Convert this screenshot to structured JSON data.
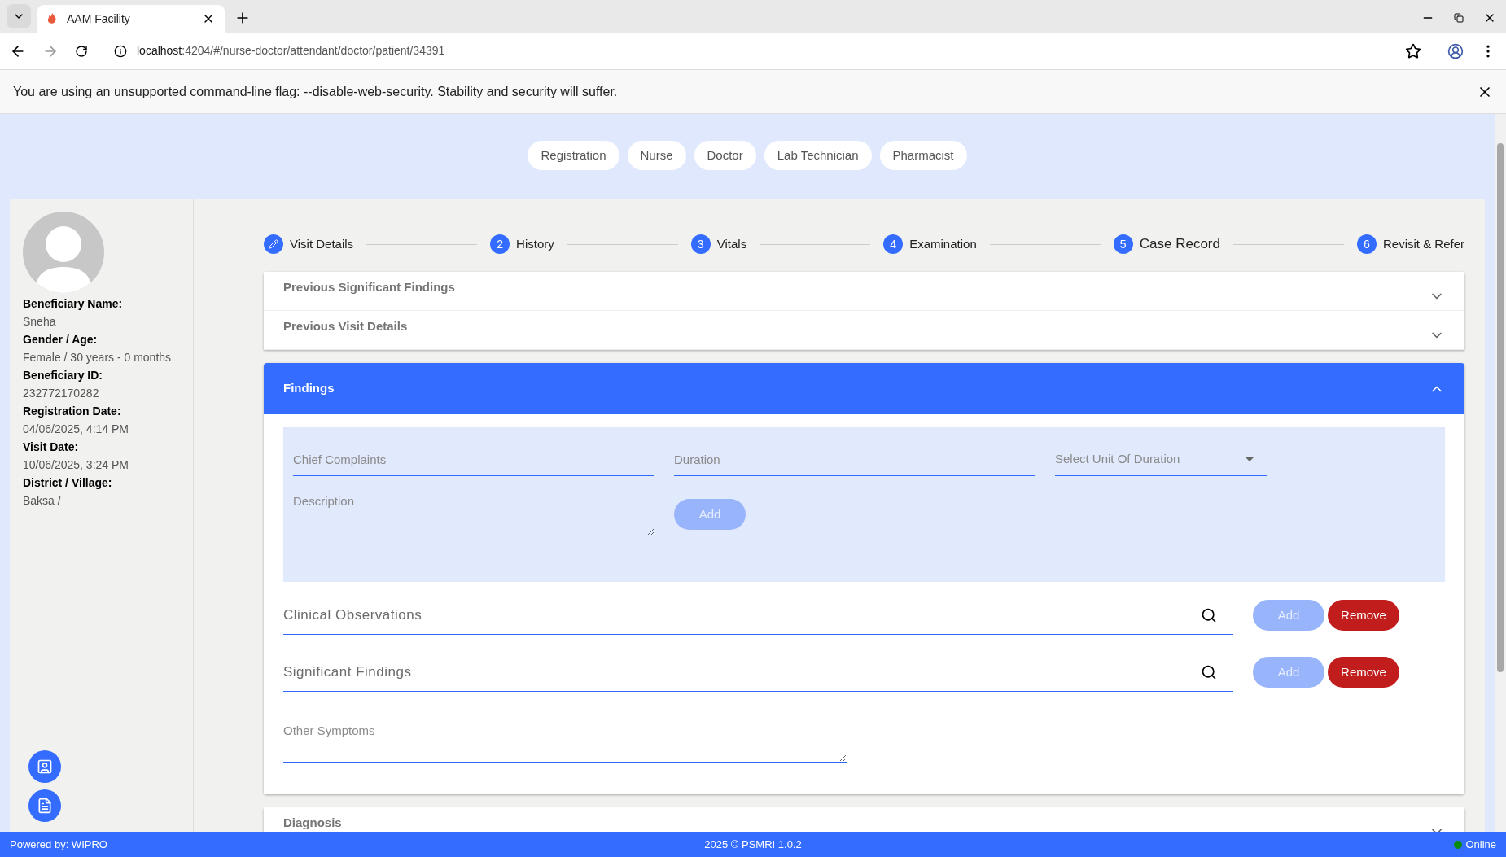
{
  "browser": {
    "tab_title": "AAM Facility",
    "url_host": "localhost",
    "url_path": ":4204/#/nurse-doctor/attendant/doctor/patient/34391"
  },
  "warning": {
    "text": "You are using an unsupported command-line flag: --disable-web-security. Stability and security will suffer."
  },
  "role_tabs": [
    {
      "label": "Registration"
    },
    {
      "label": "Nurse"
    },
    {
      "label": "Doctor"
    },
    {
      "label": "Lab Technician"
    },
    {
      "label": "Pharmacist"
    }
  ],
  "beneficiary": [
    {
      "label": "Beneficiary Name:",
      "value": "Sneha"
    },
    {
      "label": "Gender / Age:",
      "value": "Female / 30 years - 0 months"
    },
    {
      "label": "Beneficiary ID:",
      "value": "232772170282"
    },
    {
      "label": "Registration Date:",
      "value": "04/06/2025, 4:14 PM"
    },
    {
      "label": "Visit Date:",
      "value": "10/06/2025, 3:24 PM"
    },
    {
      "label": "District / Village:",
      "value": "Baksa /"
    }
  ],
  "stepper": [
    {
      "kind": "edit",
      "label": "Visit Details",
      "selected": false
    },
    {
      "kind": "number",
      "number": "2",
      "label": "History",
      "selected": false
    },
    {
      "kind": "number",
      "number": "3",
      "label": "Vitals",
      "selected": false
    },
    {
      "kind": "number",
      "number": "4",
      "label": "Examination",
      "selected": false
    },
    {
      "kind": "number",
      "number": "5",
      "label": "Case Record",
      "selected": true
    },
    {
      "kind": "number",
      "number": "6",
      "label": "Revisit & Refer",
      "selected": false
    }
  ],
  "panels": [
    {
      "title": "Previous Significant Findings",
      "expanded": false
    },
    {
      "title": "Previous Visit Details",
      "expanded": false
    },
    {
      "title": "Findings",
      "expanded": true
    },
    {
      "title": "Diagnosis",
      "expanded": false
    }
  ],
  "findings": {
    "chief_complaints": {
      "placeholder": "Chief Complaints"
    },
    "duration": {
      "placeholder": "Duration"
    },
    "unit": {
      "placeholder": "Select Unit Of Duration"
    },
    "description": {
      "placeholder": "Description"
    },
    "add_button": {
      "label": "Add",
      "disabled": true
    },
    "search_rows": [
      {
        "placeholder": "Clinical Observations",
        "add": {
          "label": "Add",
          "disabled": true
        },
        "remove": {
          "label": "Remove"
        }
      },
      {
        "placeholder": "Significant Findings",
        "add": {
          "label": "Add",
          "disabled": true
        },
        "remove": {
          "label": "Remove"
        }
      }
    ],
    "other_symptoms": {
      "placeholder": "Other Symptoms"
    }
  },
  "footer": {
    "powered_by": "Powered by: WIPRO",
    "copyright": "2025 © PSMRI 1.0.2",
    "status": "Online",
    "online": true
  }
}
